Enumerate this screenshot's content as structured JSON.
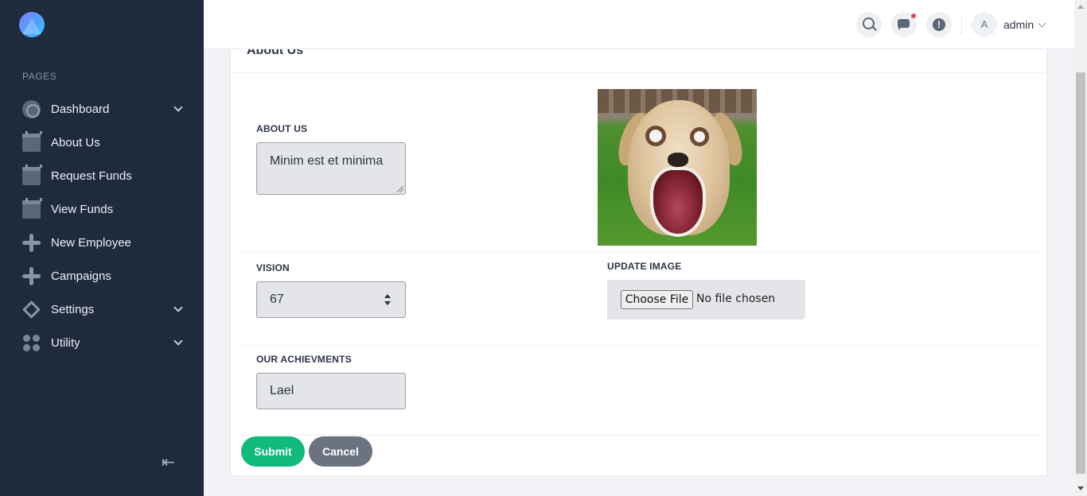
{
  "sidebar": {
    "section_title": "PAGES",
    "items": [
      {
        "label": "Dashboard",
        "icon": "dashboard-icon",
        "has_submenu": true
      },
      {
        "label": "About Us",
        "icon": "calendar-icon",
        "has_submenu": false
      },
      {
        "label": "Request Funds",
        "icon": "calendar-icon",
        "has_submenu": false
      },
      {
        "label": "View Funds",
        "icon": "calendar-icon",
        "has_submenu": false
      },
      {
        "label": "New Employee",
        "icon": "sparkle-icon",
        "has_submenu": false
      },
      {
        "label": "Campaigns",
        "icon": "sparkle-icon",
        "has_submenu": false
      },
      {
        "label": "Settings",
        "icon": "settings-icon",
        "has_submenu": true
      },
      {
        "label": "Utility",
        "icon": "utility-icon",
        "has_submenu": true
      }
    ],
    "collapse_glyph": "⇤"
  },
  "topbar": {
    "user": "admin",
    "avatar_initial": "A"
  },
  "card": {
    "title": "About Us",
    "about_label": "ABOUT US",
    "about_value": "Minim est et minima",
    "vision_label": "VISION",
    "vision_value": "67",
    "update_image_label": "UPDATE IMAGE",
    "file_button": "Choose File",
    "file_status": "No file chosen",
    "achievements_label": "OUR ACHIEVMENTS",
    "achievements_value": "Lael",
    "submit_label": "Submit",
    "cancel_label": "Cancel"
  },
  "colors": {
    "sidebar_bg": "#1f2a3c",
    "submit": "#10b97c",
    "cancel": "#6b7280",
    "notification_dot": "#f0445a"
  }
}
